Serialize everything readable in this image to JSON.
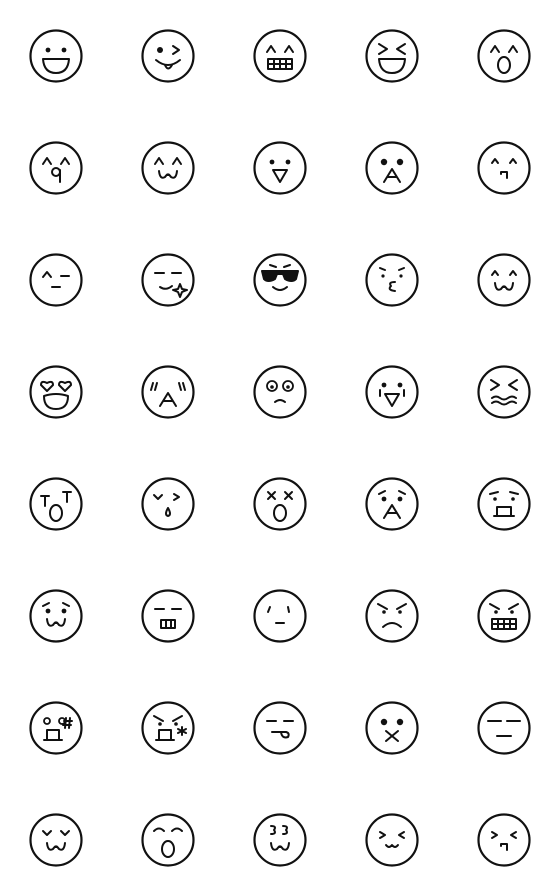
{
  "sheet": {
    "columns": 5,
    "stroke_color": "#111111",
    "background": "#ffffff",
    "faces": [
      {
        "name": "grinning-face",
        "eyes": "dot",
        "mouth": "big-smile"
      },
      {
        "name": "winking-tongue-face",
        "eyes": "wink-right",
        "mouth": "tongue-smile"
      },
      {
        "name": "grimacing-happy-face",
        "eyes": "caret",
        "mouth": "teeth"
      },
      {
        "name": "squinting-laugh-face",
        "eyes": "gt-lt",
        "mouth": "big-smile"
      },
      {
        "name": "surprised-happy-face",
        "eyes": "caret",
        "mouth": "open-o"
      },
      {
        "name": "happy-q-face",
        "eyes": "caret",
        "mouth": "q"
      },
      {
        "name": "happy-w-face",
        "eyes": "caret",
        "mouth": "w"
      },
      {
        "name": "excited-face",
        "eyes": "dot",
        "mouth": "triangle-down"
      },
      {
        "name": "cheering-face",
        "eyes": "dot-big",
        "mouth": "triangle-up"
      },
      {
        "name": "content-face",
        "eyes": "caret-small",
        "mouth": "small"
      },
      {
        "name": "relieved-face",
        "eyes": "caret-line",
        "mouth": "small-flat"
      },
      {
        "name": "smug-sparkle-face",
        "eyes": "line",
        "mouth": "smirk-sparkle"
      },
      {
        "name": "cool-sunglasses-face",
        "eyes": "sunglasses",
        "mouth": "smile"
      },
      {
        "name": "pouting-kiss-face",
        "eyes": "brows",
        "mouth": "epsilon"
      },
      {
        "name": "calm-w-face",
        "eyes": "caret-small",
        "mouth": "w"
      },
      {
        "name": "heart-eyes-face",
        "eyes": "heart",
        "mouth": "open-big"
      },
      {
        "name": "blushing-cheer-face",
        "eyes": "blush-lines",
        "mouth": "triangle-up"
      },
      {
        "name": "dizzy-eyes-face",
        "eyes": "round",
        "mouth": "frown-small"
      },
      {
        "name": "crying-happy-face",
        "eyes": "dot-tears",
        "mouth": "triangle-down"
      },
      {
        "name": "wavy-mouth-face",
        "eyes": "gt-lt",
        "mouth": "wavy"
      },
      {
        "name": "crying-face",
        "eyes": "t",
        "mouth": "open-o"
      },
      {
        "name": "sleepy-drool-face",
        "eyes": "v-wink",
        "mouth": "drop"
      },
      {
        "name": "knocked-out-face",
        "eyes": "x",
        "mouth": "open-o"
      },
      {
        "name": "shocked-face",
        "eyes": "dot-brows",
        "mouth": "triangle-up"
      },
      {
        "name": "worried-face",
        "eyes": "brows-down",
        "mouth": "box"
      },
      {
        "name": "sad-w-face",
        "eyes": "dot-brows",
        "mouth": "w"
      },
      {
        "name": "nervous-teeth-face",
        "eyes": "line",
        "mouth": "teeth-small"
      },
      {
        "name": "indifferent-face",
        "eyes": "tick",
        "mouth": "small-flat"
      },
      {
        "name": "angry-frown-face",
        "eyes": "angry",
        "mouth": "frown"
      },
      {
        "name": "furious-teeth-face",
        "eyes": "angry",
        "mouth": "teeth"
      },
      {
        "name": "shouting-hash-face",
        "eyes": "round-small",
        "mouth": "box-hash"
      },
      {
        "name": "annoyed-star-face",
        "eyes": "angry",
        "mouth": "box-star"
      },
      {
        "name": "tongue-out-face",
        "eyes": "line",
        "mouth": "tongue-side"
      },
      {
        "name": "zipped-x-face",
        "eyes": "dot-big",
        "mouth": "x"
      },
      {
        "name": "expressionless-face",
        "eyes": "line-long",
        "mouth": "flat"
      },
      {
        "name": "pleased-w-face",
        "eyes": "v",
        "mouth": "w"
      },
      {
        "name": "astonished-face",
        "eyes": "brow-arc",
        "mouth": "open-o"
      },
      {
        "name": "three-eyes-w-face",
        "eyes": "three",
        "mouth": "w"
      },
      {
        "name": "cat-mouth-face",
        "eyes": "gt-lt-small",
        "mouth": "cat"
      },
      {
        "name": "shy-face",
        "eyes": "gt-lt-small",
        "mouth": "small"
      }
    ]
  }
}
